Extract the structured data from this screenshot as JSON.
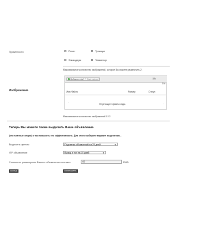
{
  "privacy": {
    "label": "Приватности",
    "options": [
      {
        "label": "Рэпит"
      },
      {
        "label": "Тупиаум"
      },
      {
        "label": "Эпизодиум"
      },
      {
        "label": "Тимменор"
      }
    ]
  },
  "image": {
    "max_note_top": "Максимальное количество изображений, которое Вы можете разместить 2.",
    "label": "Изображение",
    "add_files_label": "Добавить файлы",
    "start_upload_label": "Start upload",
    "percent_label": "0%",
    "size_label": "0 b",
    "columns": {
      "filename": "Имя Файла",
      "size": "Размер",
      "status": "Статус"
    },
    "drop_hint": "Перетащите файлы сюда.",
    "max_note_bottom": "Максимальное количество изображений 0 / 2"
  },
  "highlight": {
    "title": "Теперь Вы можете также выделить Ваше объявление",
    "subtitle": "(это платные опции) и так повысить его эффективность. Для этого выберите вариант выделения...",
    "highlight_label": "Выделить цветом",
    "highlight_value": "Подсветка объявлений на 20 дней",
    "vip_label": "VIP объявление",
    "vip_value": "Вывод в топ на 10 дней",
    "cost_label": "Стоимость размещения Вашего объявления составит",
    "cost_value": "00",
    "currency": "RUB"
  },
  "actions": {
    "back_label": "НАЗАД",
    "save_label": "СОХРАНИТЬ"
  }
}
